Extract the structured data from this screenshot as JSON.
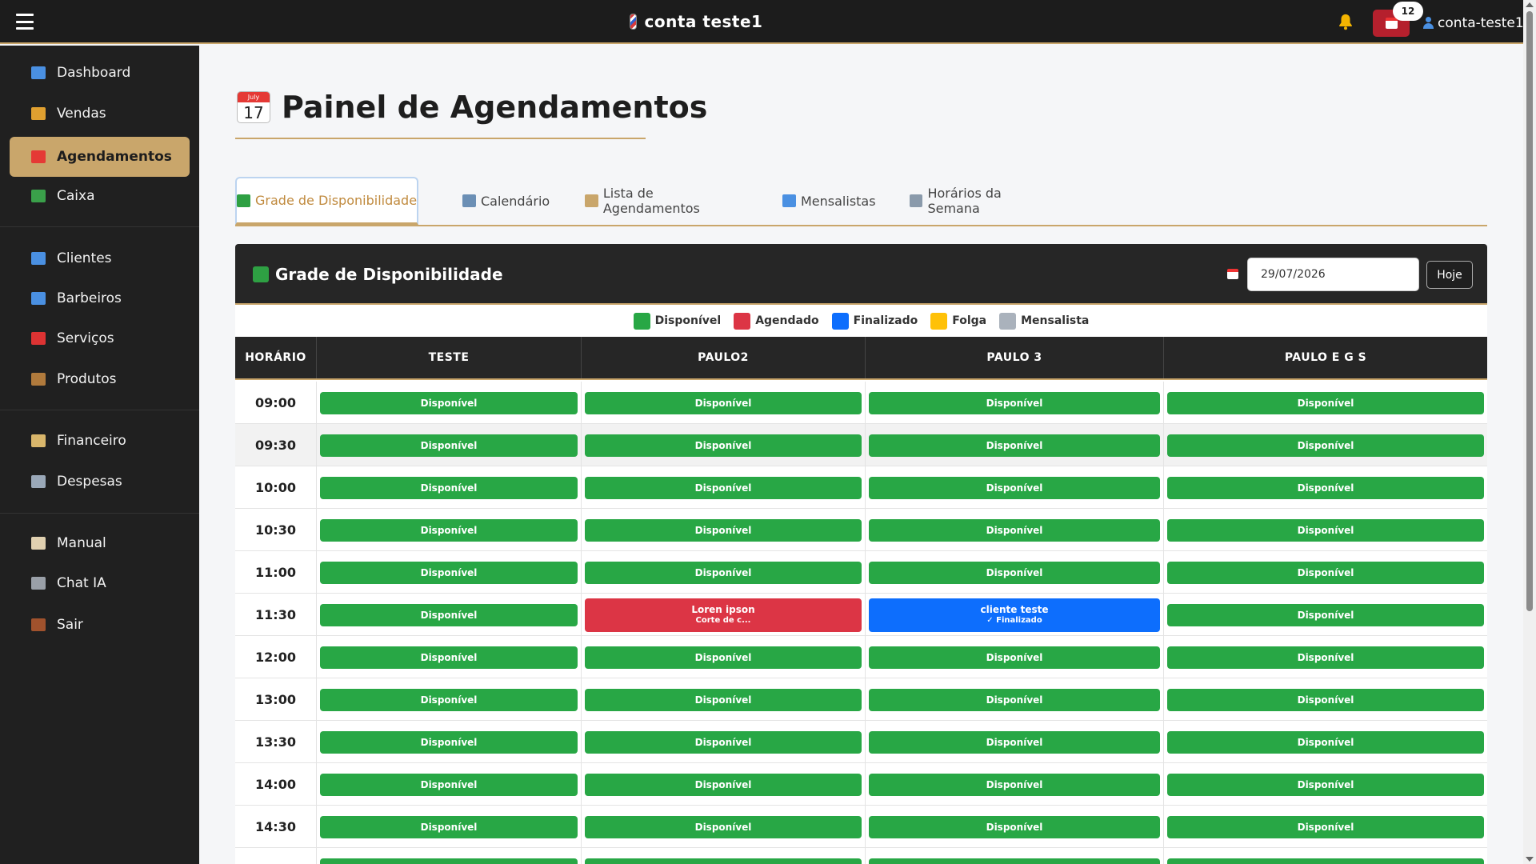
{
  "header": {
    "brand": "conta teste1",
    "notifications_count": "12",
    "user": "conta-teste1"
  },
  "sidebar": {
    "items": [
      {
        "label": "Dashboard",
        "icon": "chart-icon",
        "color": "#4a90e2"
      },
      {
        "label": "Vendas",
        "icon": "money-bag-icon",
        "color": "#e0a030"
      },
      {
        "label": "Agendamentos",
        "icon": "calendar-icon",
        "color": "#e53935",
        "active": true
      },
      {
        "label": "Caixa",
        "icon": "cash-icon",
        "color": "#3aa04a"
      },
      {
        "label": "Clientes",
        "icon": "user-icon",
        "color": "#4a90e2"
      },
      {
        "label": "Barbeiros",
        "icon": "users-icon",
        "color": "#4a90e2"
      },
      {
        "label": "Serviços",
        "icon": "scissors-icon",
        "color": "#d33"
      },
      {
        "label": "Produtos",
        "icon": "box-icon",
        "color": "#b07a3c"
      },
      {
        "label": "Financeiro",
        "icon": "clipboard-icon",
        "color": "#d9b66b"
      },
      {
        "label": "Despesas",
        "icon": "chart-down-icon",
        "color": "#9aa8b8"
      },
      {
        "label": "Manual",
        "icon": "book-icon",
        "color": "#e0d0b0"
      },
      {
        "label": "Chat IA",
        "icon": "robot-icon",
        "color": "#9aa0a8"
      },
      {
        "label": "Sair",
        "icon": "door-icon",
        "color": "#a0522d"
      }
    ]
  },
  "page": {
    "title": "Painel de Agendamentos",
    "cal_month": "July",
    "cal_day": "17"
  },
  "tabs": [
    {
      "label": "Grade de Disponibilidade",
      "icon": "green-square-icon",
      "active": true
    },
    {
      "label": "Calendário",
      "icon": "calendar-icon"
    },
    {
      "label": "Lista de Agendamentos",
      "icon": "clipboard-icon"
    },
    {
      "label": "Mensalistas",
      "icon": "refresh-icon"
    },
    {
      "label": "Horários da Semana",
      "icon": "gear-icon"
    }
  ],
  "panel": {
    "title": "Grade de Disponibilidade",
    "date_value": "29/07/2026",
    "today_label": "Hoje"
  },
  "legend": [
    {
      "label": "Disponível",
      "color": "#28a745"
    },
    {
      "label": "Agendado",
      "color": "#dc3545"
    },
    {
      "label": "Finalizado",
      "color": "#0d6efd"
    },
    {
      "label": "Folga",
      "color": "#ffc107"
    },
    {
      "label": "Mensalista",
      "color": "#aab2bc"
    }
  ],
  "grid": {
    "time_header": "HORÁRIO",
    "barbers": [
      "TESTE",
      "PAULO2",
      "PAULO 3",
      "PAULO E G S"
    ],
    "available_label": "Disponível",
    "rows": [
      {
        "time": "09:00",
        "slots": [
          {
            "status": "available"
          },
          {
            "status": "available"
          },
          {
            "status": "available"
          },
          {
            "status": "available"
          }
        ]
      },
      {
        "time": "09:30",
        "slots": [
          {
            "status": "available"
          },
          {
            "status": "available"
          },
          {
            "status": "available"
          },
          {
            "status": "available"
          }
        ]
      },
      {
        "time": "10:00",
        "slots": [
          {
            "status": "available"
          },
          {
            "status": "available"
          },
          {
            "status": "available"
          },
          {
            "status": "available"
          }
        ]
      },
      {
        "time": "10:30",
        "slots": [
          {
            "status": "available"
          },
          {
            "status": "available"
          },
          {
            "status": "available"
          },
          {
            "status": "available"
          }
        ]
      },
      {
        "time": "11:00",
        "slots": [
          {
            "status": "available"
          },
          {
            "status": "available"
          },
          {
            "status": "available"
          },
          {
            "status": "available"
          }
        ]
      },
      {
        "time": "11:30",
        "slots": [
          {
            "status": "available"
          },
          {
            "status": "booked",
            "client": "Loren ipson",
            "detail": "Corte de c..."
          },
          {
            "status": "done",
            "client": "cliente teste",
            "detail": "✓ Finalizado"
          },
          {
            "status": "available"
          }
        ]
      },
      {
        "time": "12:00",
        "slots": [
          {
            "status": "available"
          },
          {
            "status": "available"
          },
          {
            "status": "available"
          },
          {
            "status": "available"
          }
        ]
      },
      {
        "time": "13:00",
        "slots": [
          {
            "status": "available"
          },
          {
            "status": "available"
          },
          {
            "status": "available"
          },
          {
            "status": "available"
          }
        ]
      },
      {
        "time": "13:30",
        "slots": [
          {
            "status": "available"
          },
          {
            "status": "available"
          },
          {
            "status": "available"
          },
          {
            "status": "available"
          }
        ]
      },
      {
        "time": "14:00",
        "slots": [
          {
            "status": "available"
          },
          {
            "status": "available"
          },
          {
            "status": "available"
          },
          {
            "status": "available"
          }
        ]
      },
      {
        "time": "14:30",
        "slots": [
          {
            "status": "available"
          },
          {
            "status": "available"
          },
          {
            "status": "available"
          },
          {
            "status": "available"
          }
        ]
      },
      {
        "time": "",
        "slots": [
          {
            "status": "available"
          },
          {
            "status": "available"
          },
          {
            "status": "available"
          },
          {
            "status": "available"
          }
        ]
      }
    ]
  }
}
